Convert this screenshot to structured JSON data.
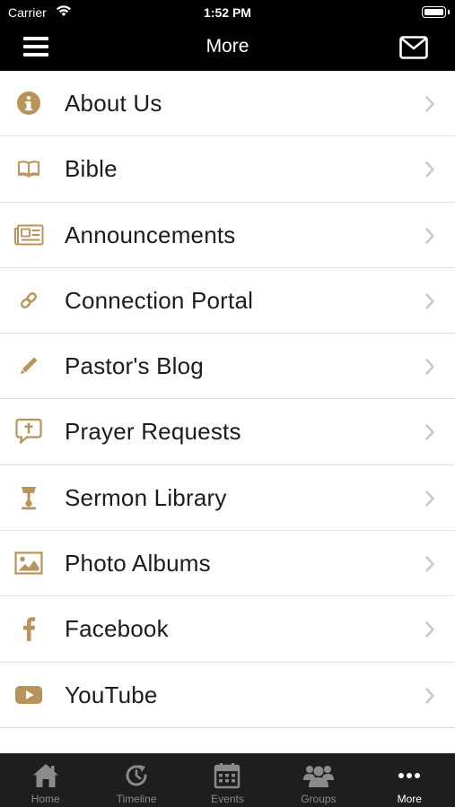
{
  "status_bar": {
    "carrier": "Carrier",
    "time": "1:52 PM"
  },
  "nav": {
    "title": "More"
  },
  "colors": {
    "accent": "#b8935a",
    "bar_background": "#000000",
    "tab_background": "#1e1e1e",
    "tab_inactive": "#8a8a8a",
    "tab_active": "#ffffff"
  },
  "menu_items": [
    {
      "label": "About Us",
      "icon": "info-icon"
    },
    {
      "label": "Bible",
      "icon": "book-icon"
    },
    {
      "label": "Announcements",
      "icon": "newspaper-icon"
    },
    {
      "label": "Connection Portal",
      "icon": "link-icon"
    },
    {
      "label": "Pastor's Blog",
      "icon": "pencil-icon"
    },
    {
      "label": "Prayer Requests",
      "icon": "prayer-bubble-icon"
    },
    {
      "label": "Sermon Library",
      "icon": "lectern-icon"
    },
    {
      "label": "Photo Albums",
      "icon": "photo-icon"
    },
    {
      "label": "Facebook",
      "icon": "facebook-icon"
    },
    {
      "label": "YouTube",
      "icon": "youtube-icon"
    }
  ],
  "tabs": [
    {
      "label": "Home",
      "icon": "home-icon",
      "active": false
    },
    {
      "label": "Timeline",
      "icon": "timeline-icon",
      "active": false
    },
    {
      "label": "Events",
      "icon": "calendar-icon",
      "active": false
    },
    {
      "label": "Groups",
      "icon": "groups-icon",
      "active": false
    },
    {
      "label": "More",
      "icon": "more-dots-icon",
      "active": true
    }
  ]
}
